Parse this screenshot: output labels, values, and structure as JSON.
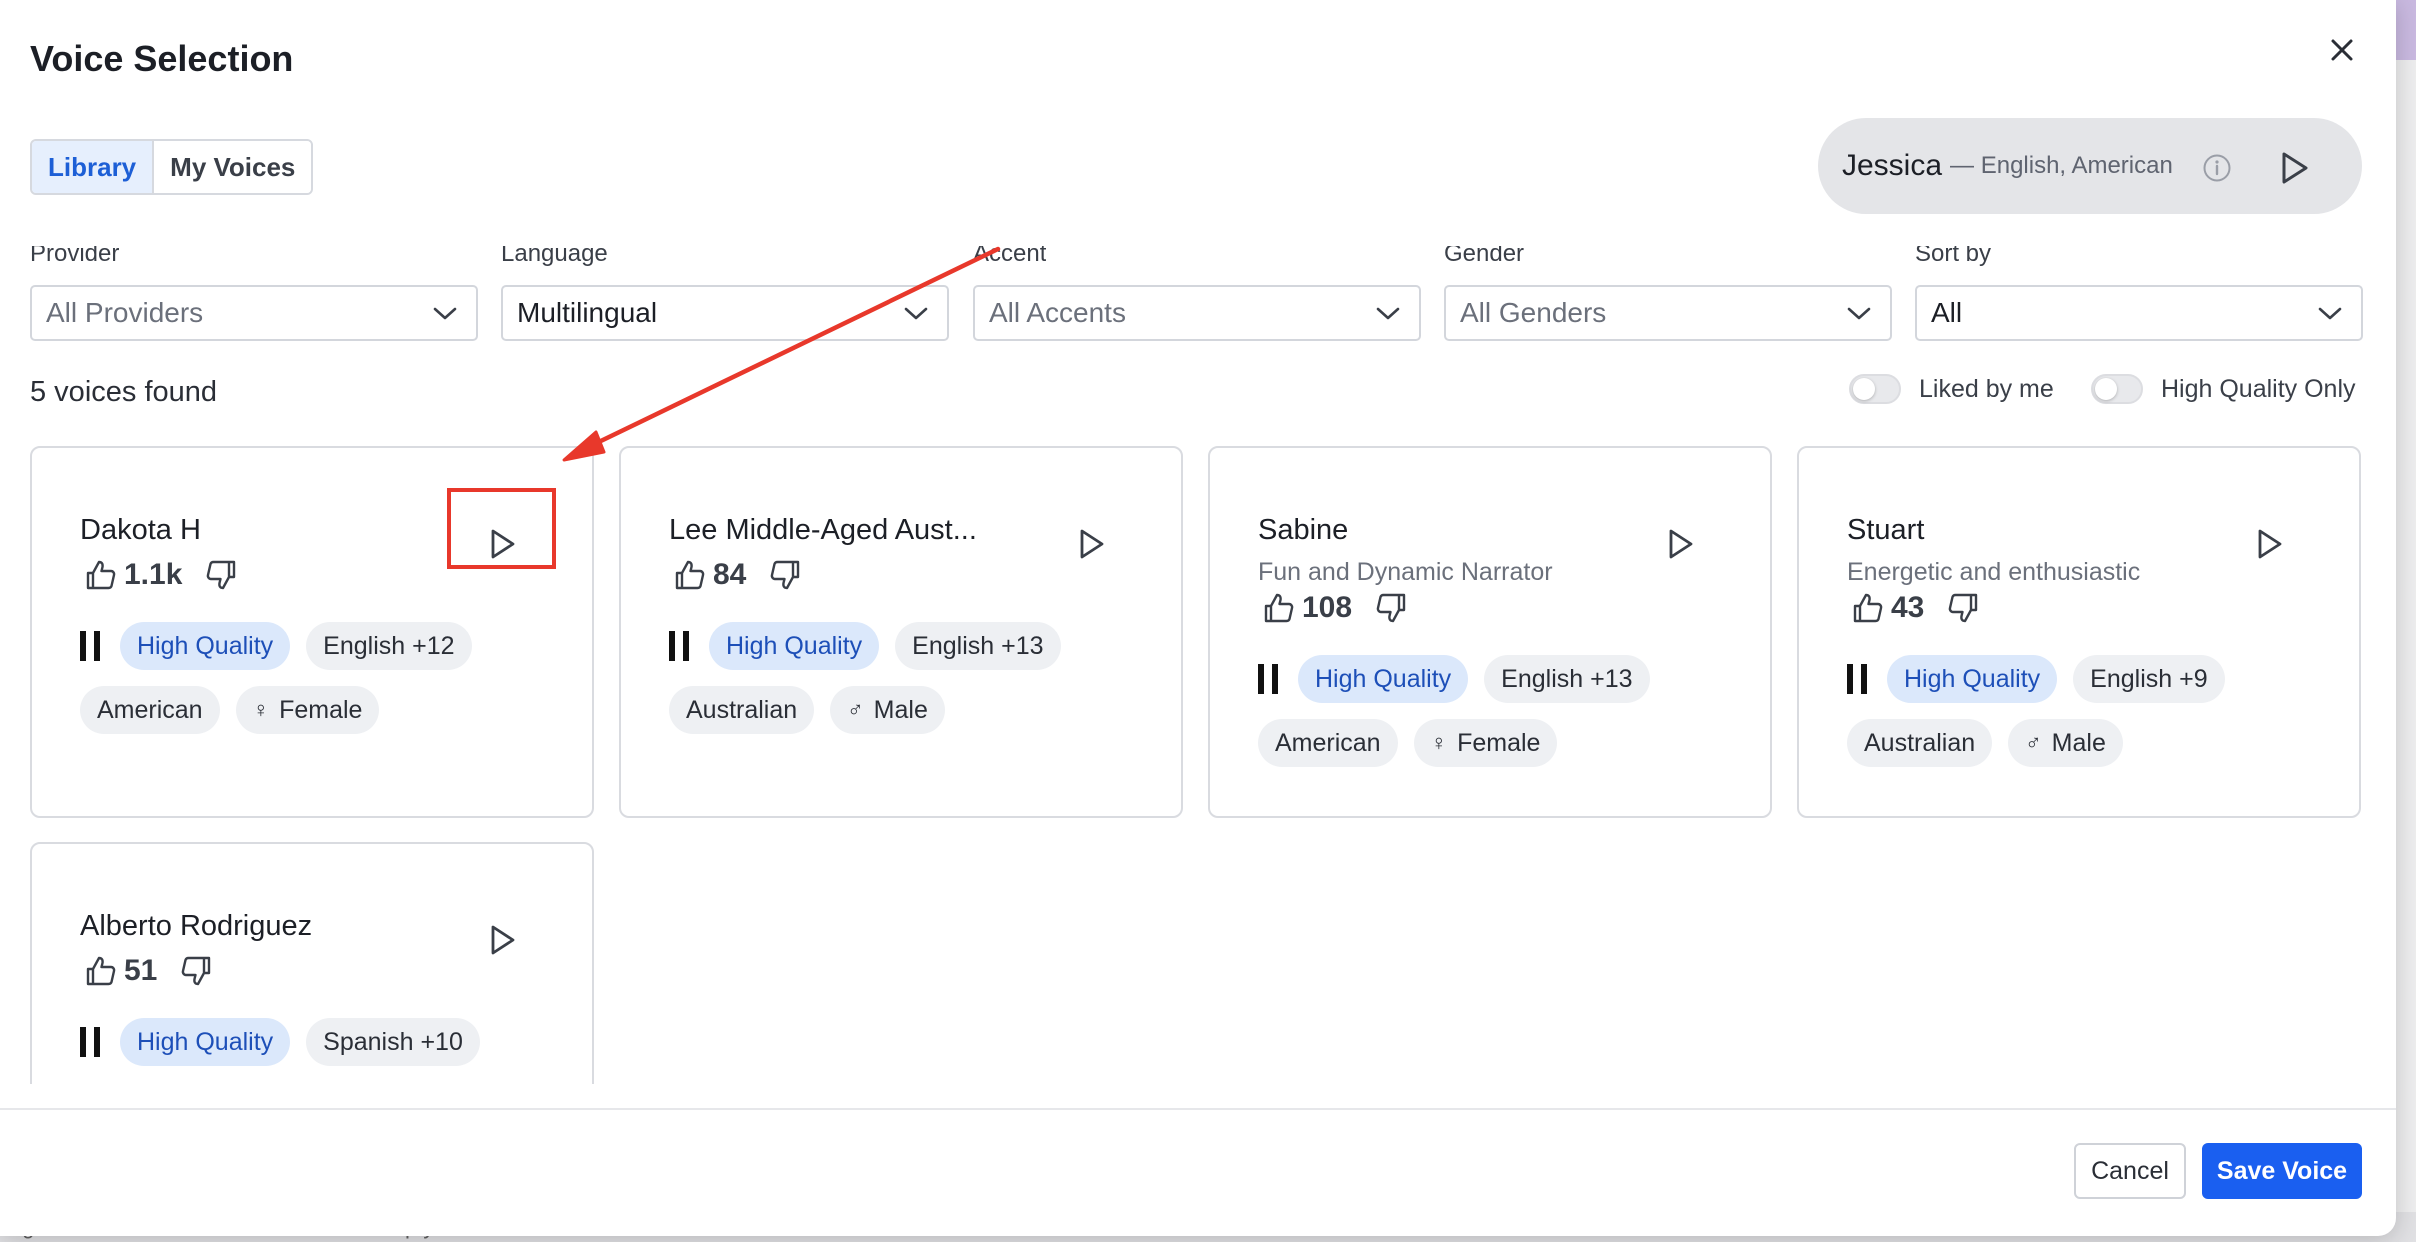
{
  "modal": {
    "title": "Voice Selection"
  },
  "tabs": [
    {
      "label": "Library",
      "active": true
    },
    {
      "label": "My Voices",
      "active": false
    }
  ],
  "current_voice": {
    "name": "Jessica",
    "detail": "— English, American"
  },
  "filters": [
    {
      "label": "Provider",
      "value": "All Providers",
      "placeholder": true
    },
    {
      "label": "Language",
      "value": "Multilingual",
      "placeholder": false
    },
    {
      "label": "Accent",
      "value": "All Accents",
      "placeholder": true
    },
    {
      "label": "Gender",
      "value": "All Genders",
      "placeholder": true
    },
    {
      "label": "Sort by",
      "value": "All",
      "placeholder": false
    }
  ],
  "results": {
    "count_text": "5 voices found"
  },
  "toggles": [
    {
      "label": "Liked by me",
      "on": false
    },
    {
      "label": "High Quality Only",
      "on": false
    }
  ],
  "voices": [
    {
      "name": "Dakota H",
      "description": "",
      "likes": "1.1k",
      "quality": "High Quality",
      "language": "English +12",
      "accent": "American",
      "gender_symbol": "♀",
      "gender": "Female"
    },
    {
      "name": "Lee Middle-Aged Aust...",
      "description": "",
      "likes": "84",
      "quality": "High Quality",
      "language": "English +13",
      "accent": "Australian",
      "gender_symbol": "♂",
      "gender": "Male"
    },
    {
      "name": "Sabine",
      "description": "Fun and Dynamic Narrator",
      "likes": "108",
      "quality": "High Quality",
      "language": "English +13",
      "accent": "American",
      "gender_symbol": "♀",
      "gender": "Female"
    },
    {
      "name": "Stuart",
      "description": "Energetic and enthusiastic",
      "likes": "43",
      "quality": "High Quality",
      "language": "English +9",
      "accent": "Australian",
      "gender_symbol": "♂",
      "gender": "Male"
    },
    {
      "name": "Alberto Rodriguez",
      "description": "",
      "likes": "51",
      "quality": "High Quality",
      "language": "Spanish +10",
      "accent": "",
      "gender_symbol": "",
      "gender": ""
    }
  ],
  "footer": {
    "cancel_label": "Cancel",
    "save_label": "Save Voice"
  },
  "background": {
    "bottom_text": "ng Seasons of Sallertown. How can I help you?"
  },
  "colors": {
    "primary": "#1a5ff0",
    "annotation": "#e8382b",
    "tag_hq_bg": "#dbe8fb",
    "tag_bg": "#eef0f3"
  },
  "icons": {
    "close": "close-icon",
    "play": "play-icon",
    "info": "info-icon",
    "chevron": "chevron-down-icon",
    "thumbs_up": "thumbs-up-icon",
    "thumbs_down": "thumbs-down-icon",
    "pause": "pause-icon"
  }
}
